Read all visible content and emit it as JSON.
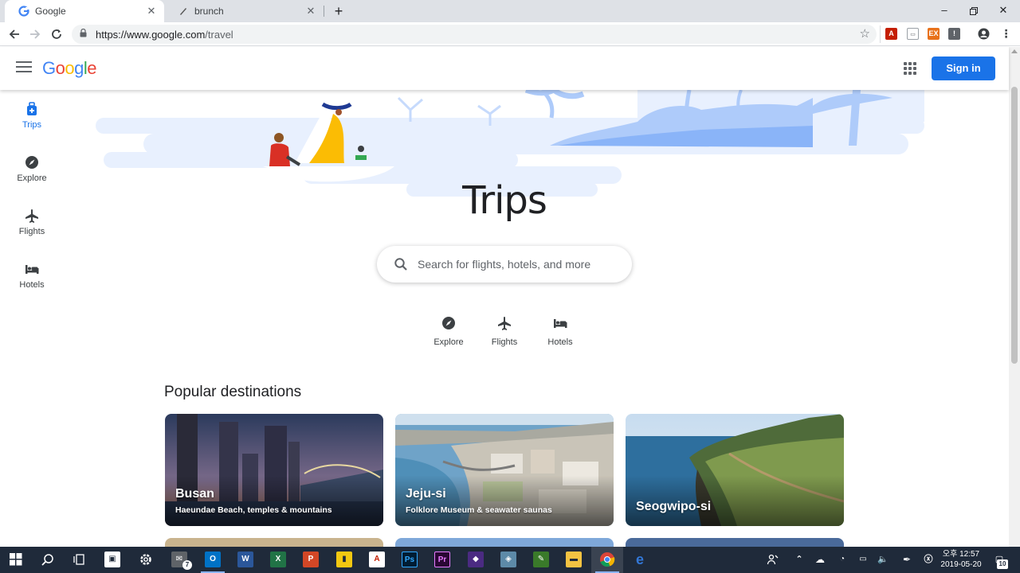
{
  "browser": {
    "tabs": [
      {
        "title": "Google",
        "active": true
      },
      {
        "title": "brunch",
        "active": false
      }
    ],
    "url_host": "https://www.google.com",
    "url_path": "/travel",
    "window_controls": [
      "minimize-icon",
      "maximize-icon",
      "close-icon"
    ]
  },
  "app": {
    "logo_text": "Google",
    "signin_label": "Sign in"
  },
  "sidenav": {
    "items": [
      {
        "label": "Trips",
        "icon": "suitcase-icon",
        "active": true
      },
      {
        "label": "Explore",
        "icon": "compass-icon",
        "active": false
      },
      {
        "label": "Flights",
        "icon": "airplane-icon",
        "active": false
      },
      {
        "label": "Hotels",
        "icon": "bed-icon",
        "active": false
      }
    ]
  },
  "main": {
    "title": "Trips",
    "search": {
      "placeholder": "Search for flights, hotels, and more"
    },
    "quick_links": [
      {
        "label": "Explore",
        "icon": "compass-icon"
      },
      {
        "label": "Flights",
        "icon": "airplane-icon"
      },
      {
        "label": "Hotels",
        "icon": "bed-icon"
      }
    ],
    "popular_title": "Popular destinations",
    "destinations": [
      {
        "name": "Busan",
        "desc": "Haeundae Beach, temples & mountains"
      },
      {
        "name": "Jeju-si",
        "desc": "Folklore Museum & seawater saunas"
      },
      {
        "name": "Seogwipo-si",
        "desc": ""
      }
    ]
  },
  "taskbar": {
    "time": "오후 12:57",
    "date": "2019-05-20",
    "notification_count": "10",
    "mail_badge": "7"
  },
  "colors": {
    "brand_blue": "#1a73e8",
    "hero_light_blue": "#e8f0fe",
    "hero_mid_blue": "#aecbfa",
    "taskbar_bg": "#1f2a3a"
  }
}
